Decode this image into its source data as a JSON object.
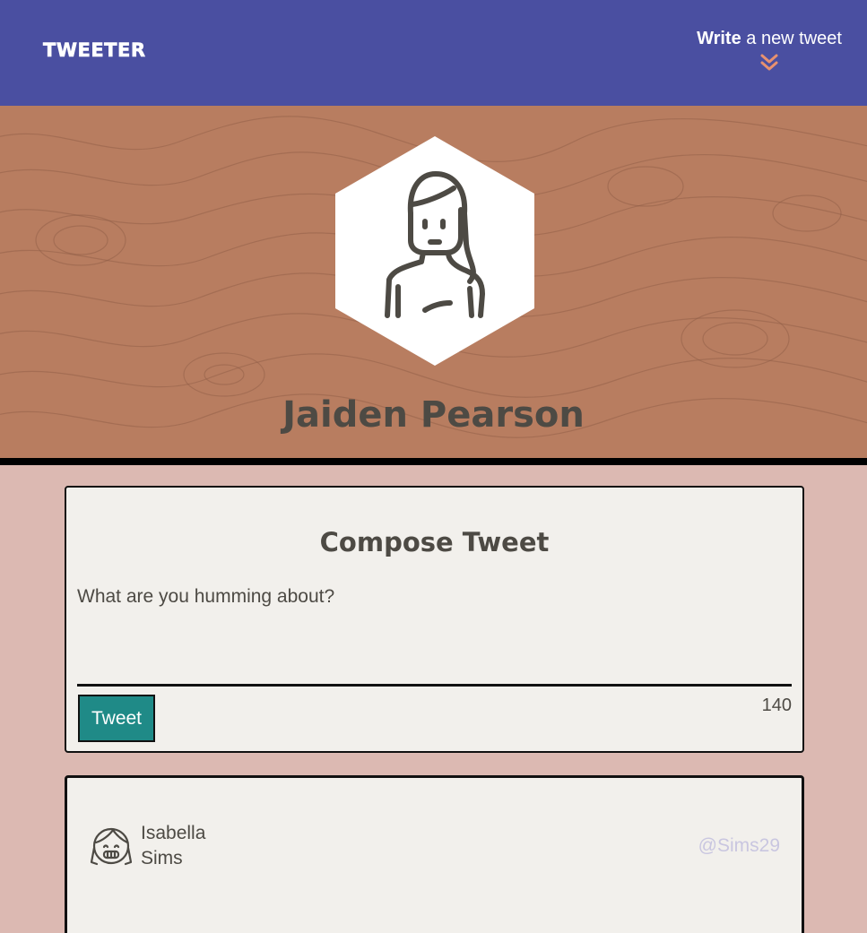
{
  "nav": {
    "brand": "TWEETER",
    "write_strong": "Write",
    "write_rest": " a new tweet",
    "chevron_color": "#e8916f"
  },
  "profile": {
    "name": "Jaiden Pearson",
    "avatar_icon": "woman-avatar-icon"
  },
  "compose": {
    "title": "Compose Tweet",
    "placeholder": "What are you humming about?",
    "button_label": "Tweet",
    "counter": "140"
  },
  "tweets": [
    {
      "first_name": "Isabella",
      "last_name": "Sims",
      "handle": "@Sims29",
      "avatar_icon": "girl-avatar-icon"
    }
  ],
  "colors": {
    "nav_bg": "#4a4fa1",
    "banner_bg": "#b87d60",
    "page_bg": "#dcb9b2",
    "card_bg": "#f2f0ec",
    "button_bg": "#1f8a87",
    "handle": "#c9c6e0"
  }
}
